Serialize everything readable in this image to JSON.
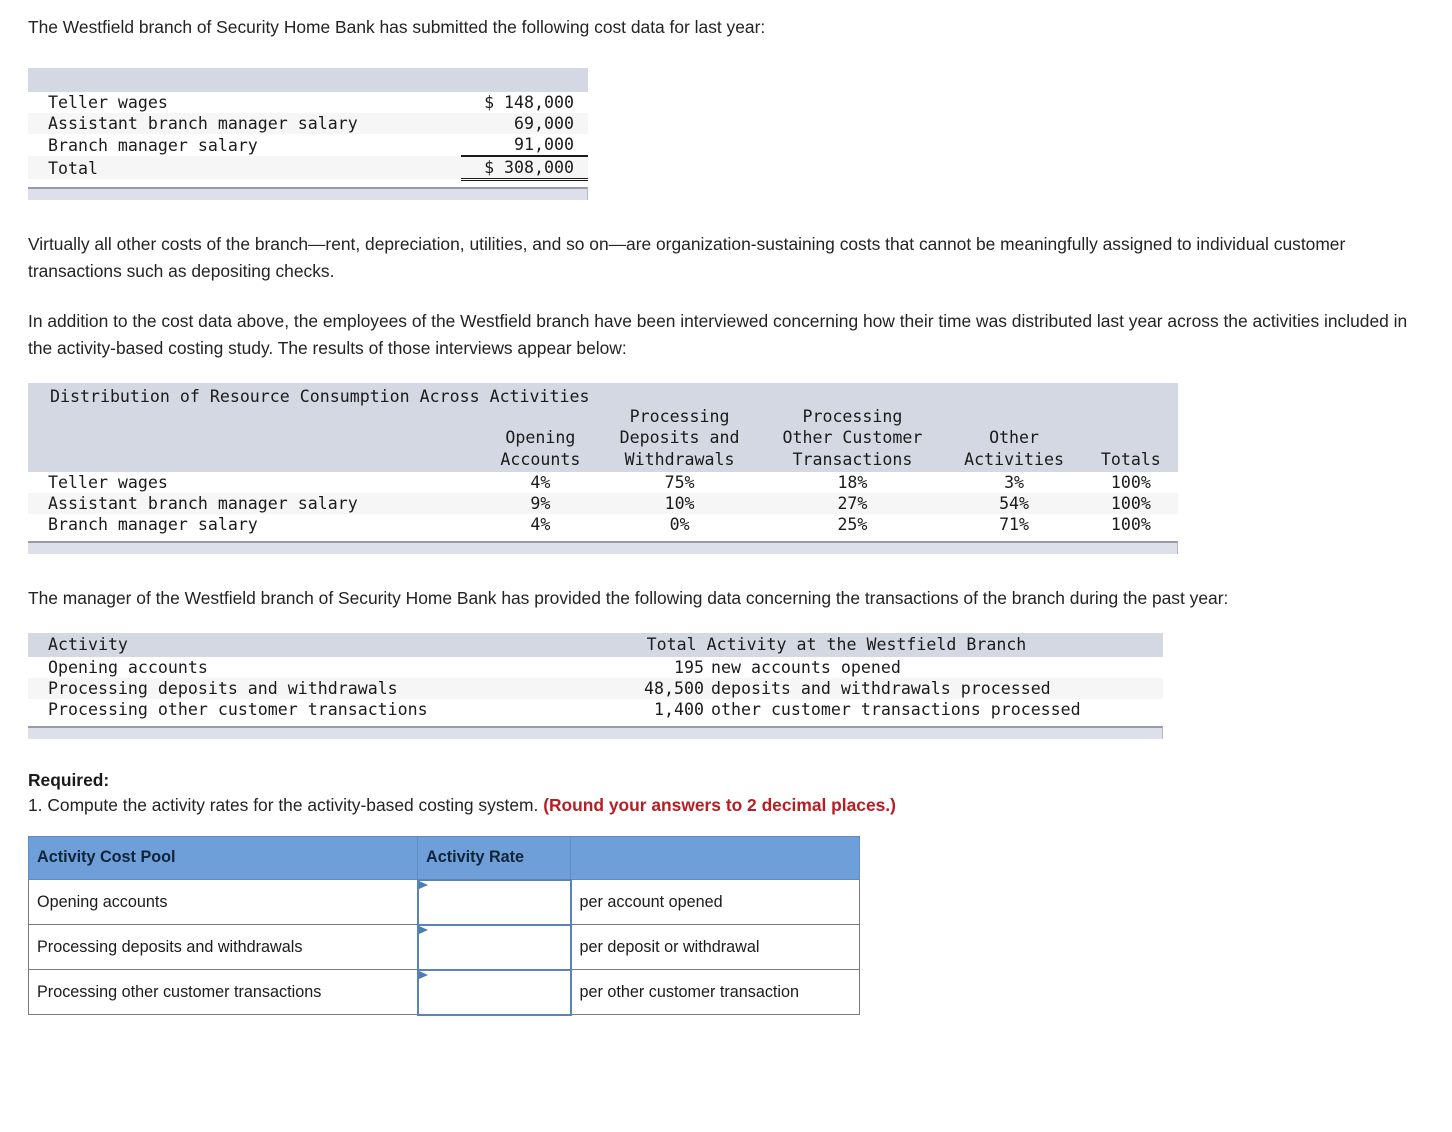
{
  "intro": {
    "paragraph": "The Westfield branch of Security Home Bank has submitted the following cost data for last year:"
  },
  "cost_table": {
    "rows": [
      {
        "label": "Teller wages",
        "amount": "$ 148,000"
      },
      {
        "label": "Assistant branch manager salary",
        "amount": "69,000"
      },
      {
        "label": "Branch manager salary",
        "amount": "91,000"
      }
    ],
    "total": {
      "label": "Total",
      "amount": "$ 308,000"
    }
  },
  "body": {
    "paragraph_2": "Virtually all other costs of the branch—rent, depreciation, utilities, and so on—are organization-sustaining costs that cannot be meaningfully assigned to individual customer transactions such as depositing checks.",
    "paragraph_3": "In addition to the cost data above, the employees of the Westfield branch have been interviewed concerning how their time was distributed last year across the activities included in the activity-based costing study. The results of those interviews appear below:",
    "paragraph_4": "The manager of the Westfield branch of Security Home Bank has provided the following data concerning the transactions of the branch during the past year:"
  },
  "distribution_table": {
    "title": "Distribution of Resource Consumption Across Activities",
    "headers": [
      "Opening\nAccounts",
      "Processing\nDeposits and\nWithdrawals",
      "Processing\nOther Customer\nTransactions",
      "Other\nActivities",
      "Totals"
    ],
    "rows": [
      {
        "label": "Teller wages",
        "opening_accounts": "4%",
        "processing_deposits_withdrawals": "75%",
        "processing_other_customer_transactions": "18%",
        "other_activities": "3%",
        "totals": "100%"
      },
      {
        "label": "Assistant branch manager salary",
        "opening_accounts": "9%",
        "processing_deposits_withdrawals": "10%",
        "processing_other_customer_transactions": "27%",
        "other_activities": "54%",
        "totals": "100%"
      },
      {
        "label": "Branch manager salary",
        "opening_accounts": "4%",
        "processing_deposits_withdrawals": "0%",
        "processing_other_customer_transactions": "25%",
        "other_activities": "71%",
        "totals": "100%"
      }
    ]
  },
  "activity_table": {
    "header_activity": "Activity",
    "header_total": "Total Activity at the Westfield Branch",
    "rows": [
      {
        "activity": "Opening accounts",
        "amount": "195",
        "description": "new accounts opened"
      },
      {
        "activity": "Processing deposits and withdrawals",
        "amount": "48,500",
        "description": "deposits and withdrawals processed"
      },
      {
        "activity": "Processing other customer transactions",
        "amount": "1,400",
        "description": "other customer transactions processed"
      }
    ]
  },
  "required": {
    "label": "Required:",
    "item_1_text": "1. Compute the activity rates for the activity-based costing system. ",
    "item_1_note": "(Round your answers to 2 decimal places.)",
    "note_color": "#b81d22"
  },
  "answer_table": {
    "headers": {
      "pool": "Activity Cost Pool",
      "rate": "Activity Rate",
      "unit": ""
    },
    "rows": [
      {
        "pool": "Opening accounts",
        "rate": "",
        "unit": "per account opened"
      },
      {
        "pool": "Processing deposits and withdrawals",
        "rate": "",
        "unit": "per deposit or withdrawal"
      },
      {
        "pool": "Processing other customer transactions",
        "rate": "",
        "unit": "per other customer transaction"
      }
    ],
    "header_color": "#6f9fd8"
  }
}
